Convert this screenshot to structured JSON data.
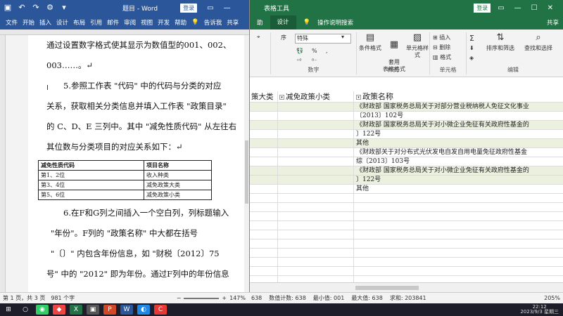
{
  "word": {
    "title": "题目 - Word",
    "login": "登录",
    "tabs": [
      "文件",
      "开始",
      "插入",
      "设计",
      "布局",
      "引用",
      "邮件",
      "审阅",
      "视图",
      "开发",
      "帮助",
      "告诉我",
      "共享"
    ],
    "paragraphs": [
      "通过设置数字格式使其显示为数值型的001、002、",
      "003……。↵",
      "5.参照工作表 \"代码\" 中的代码与分类的对应",
      "关系，获取相关分类信息并填入工作表 \"政策目录\"",
      "的 C、D、E 三列中。其中 \"减免性质代码\" 从左往右",
      "其位数与分类项目的对应关系如下：↵"
    ],
    "table": {
      "headers": [
        "减免性质代码",
        "项目名称"
      ],
      "rows": [
        [
          "第1、2位",
          "收入种类"
        ],
        [
          "第3、4位",
          "减免政策大类"
        ],
        [
          "第5、6位",
          "减免政策小类"
        ]
      ]
    },
    "paragraphs_after": [
      "6.在F和G列之间插入一个空白列，列标题输入",
      "\"年份\"。F列的 \"政策名称\" 中大都在括号",
      "\"〔〕\" 内包含年份信息，如 \"财税〔2012〕75",
      "号\" 中的 \"2012\" 即为年份。通过F列中的年份信息"
    ],
    "status": {
      "page": "第 1 页，共 3 页",
      "words": "981 个字",
      "zoom": "147%"
    }
  },
  "excel": {
    "tool_title": "表格工具",
    "login": "登录",
    "tabs": [
      "助",
      "设计",
      "操作说明搜索"
    ],
    "share": "共享",
    "ribbon": {
      "font_name": "特殊",
      "number_label": "数字",
      "style_label": "样式",
      "cell_label": "单元格",
      "edit_label": "编辑",
      "cond_format": "条件格式",
      "table_format": "套用\n表格格式",
      "cell_style": "单元格样式",
      "insert": "插入",
      "delete": "删除",
      "format": "格式",
      "sort_filter": "排序和筛选",
      "find_select": "查找和选择",
      "percent": "% ",
      "chars": "序"
    },
    "headers": {
      "col1": "策大类",
      "col2": "减免政策小类",
      "col3": "政策名称"
    },
    "rows": [
      {
        "text": "《财政部 国家税务总局关于对部分营业税纳税人免征文化事业",
        "band": true
      },
      {
        "text": "〔2013〕102号",
        "band": false
      },
      {
        "text": "《财政部 国家税务总局关于对小微企业免征有关政府性基金的",
        "band": true
      },
      {
        "text": "〕122号",
        "band": false
      },
      {
        "text": "其他",
        "band": true
      },
      {
        "text": "《财政部关于对分布式光伏发电自发自用电量免征政府性基金",
        "band": false
      },
      {
        "text": "综〔2013〕103号",
        "band": false
      },
      {
        "text": "《财政部 国家税务总局关于对小微企业免征有关政府性基金的",
        "band": true
      },
      {
        "text": "〕122号",
        "band": true
      },
      {
        "text": "其他",
        "band": false
      }
    ],
    "status": {
      "count": "638",
      "numeric_count": "数值计数: 638",
      "min": "最小值: 001",
      "max": "最大值: 638",
      "sum": "求和: 203841",
      "zoom": "205%"
    }
  },
  "taskbar": {
    "clock_time": "22:12",
    "clock_date": "2023/9/3 星期三"
  }
}
